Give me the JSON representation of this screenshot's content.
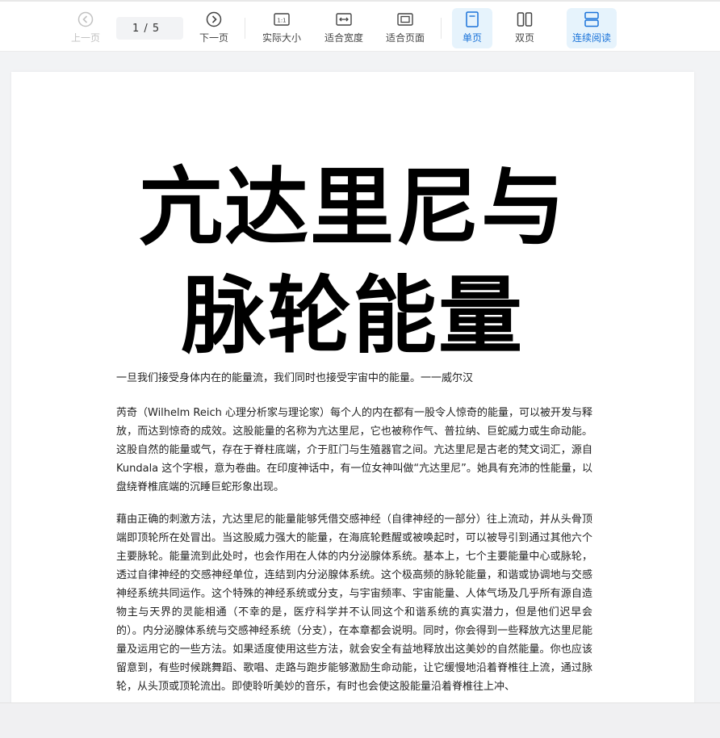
{
  "toolbar": {
    "prev_label": "上一页",
    "page_indicator": "1 / 5",
    "next_label": "下一页",
    "actual_size_label": "实际大小",
    "fit_width_label": "适合宽度",
    "fit_page_label": "适合页面",
    "single_page_label": "单页",
    "double_page_label": "双页",
    "continuous_label": "连续阅读",
    "active_color": "#1a73d9",
    "active_bg": "#e6f3fc"
  },
  "document": {
    "title_line1": "亢达里尼与",
    "title_line2": "脉轮能量",
    "quote": "一旦我们接受身体内在的能量流，我们同时也接受宇宙中的能量。一一威尔汉",
    "paragraph1": "芮奇（Wilhelm Reich 心理分析家与理论家）每个人的内在都有一股令人惊奇的能量，可以被开发与释放，而达到惊奇的成效。这股能量的名称为亢达里尼，它也被称作气、普拉纳、巨蛇威力或生命动能。这股自然的能量或气，存在于脊柱底端，介于肛门与生殖器官之间。亢达里尼是古老的梵文词汇，源自 Kundala 这个字根，意为卷曲。在印度神话中，有一位女神叫做“亢达里尼”。她具有充沛的性能量，以盘绕脊椎底端的沉睡巨蛇形象出现。",
    "paragraph2": "藉由正确的刺激方法，亢达里尼的能量能够凭借交感神经（自律神经的一部分）往上流动，并从头骨顶端即顶轮所在处冒出。当这股威力强大的能量，在海底轮甦醒或被唤起时，可以被导引到通过其他六个主要脉轮。能量流到此处时，也会作用在人体的内分泌腺体系统。基本上，七个主要能量中心或脉轮，透过自律神经的交感神经单位，连结到内分泌腺体系统。这个极高频的脉轮能量，和谐或协调地与交感神经系统共同运作。这个特殊的神经系统或分支，与宇宙频率、宇宙能量、人体气场及几乎所有源自造物主与天界的灵能相通（不幸的是，医疗科学并不认同这个和谐系统的真实潜力，但是他们迟早会的）。内分泌腺体系统与交感神经系统（分支），在本章都会说明。同时，你会得到一些释放亢达里尼能量及运用它的一些方法。如果适度使用这些方法，就会安全有益地释放出这美妙的自然能量。你也应该留意到，有些时候跳舞蹈、歌唱、走路与跑步能够激励生命动能，让它缓慢地沿着脊椎往上流，通过脉轮，从头顶或顶轮流出。即使聆听美妙的音乐，有时也会使这股能量沿着脊椎往上冲、"
  }
}
